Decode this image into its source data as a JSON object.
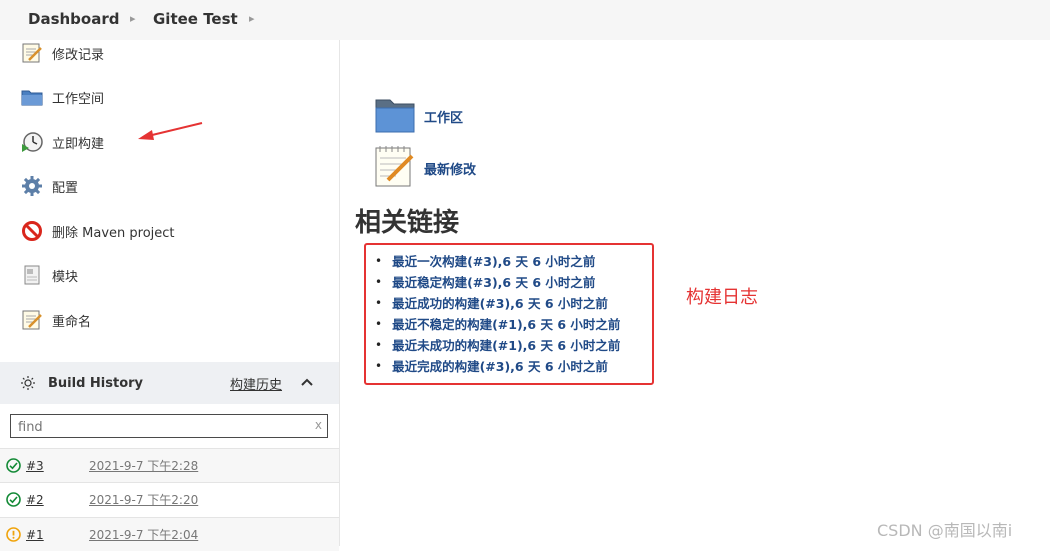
{
  "breadcrumb": [
    "Dashboard",
    "Gitee Test"
  ],
  "tasks": [
    {
      "label": "修改记录",
      "icon": "notepad-icon"
    },
    {
      "label": "工作空间",
      "icon": "folder-icon"
    },
    {
      "label": "立即构建",
      "icon": "clock-build-icon"
    },
    {
      "label": "配置",
      "icon": "gear-icon"
    },
    {
      "label": "删除 Maven project",
      "icon": "no-entry-icon"
    },
    {
      "label": "模块",
      "icon": "document-icon"
    },
    {
      "label": "重命名",
      "icon": "notepad-icon"
    }
  ],
  "build_history": {
    "title": "Build History",
    "link": "构建历史",
    "search_placeholder": "find",
    "clear": "x",
    "builds": [
      {
        "number": "#3",
        "date": "2021-9-7 下午2:28",
        "status": "success"
      },
      {
        "number": "#2",
        "date": "2021-9-7 下午2:20",
        "status": "success"
      },
      {
        "number": "#1",
        "date": "2021-9-7 下午2:04",
        "status": "unstable"
      }
    ]
  },
  "main": {
    "workspace_label": "工作区",
    "changes_label": "最新修改",
    "related_title": "相关链接",
    "related_links": [
      "最近一次构建(#3),6 天 6 小时之前",
      "最近稳定构建(#3),6 天 6 小时之前",
      "最近成功的构建(#3),6 天 6 小时之前",
      "最近不稳定的构建(#1),6 天 6 小时之前",
      "最近未成功的构建(#1),6 天 6 小时之前",
      "最近完成的构建(#3),6 天 6 小时之前"
    ]
  },
  "annotation": "构建日志",
  "watermark": "CSDN @南国以南i",
  "colors": {
    "link": "#204a87",
    "annotation_red": "#e53333",
    "success": "#138a36",
    "unstable": "#f0a30a"
  }
}
